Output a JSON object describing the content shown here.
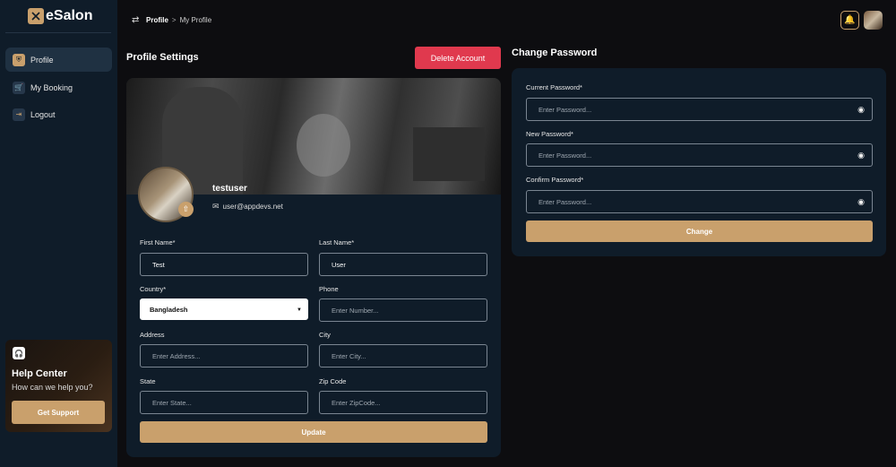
{
  "brand": {
    "name": "eSalon",
    "accent": "#c9a06c",
    "danger": "#e0394e"
  },
  "sidebar": {
    "items": [
      {
        "label": "Profile",
        "icon": "shield-user-icon",
        "active": true
      },
      {
        "label": "My Booking",
        "icon": "cart-icon",
        "active": false
      },
      {
        "label": "Logout",
        "icon": "logout-icon",
        "active": false
      }
    ],
    "help": {
      "title": "Help Center",
      "subtitle": "How can we help you?",
      "button": "Get Support"
    }
  },
  "header": {
    "breadcrumb": [
      "Profile",
      "My Profile"
    ]
  },
  "profile": {
    "title": "Profile Settings",
    "delete_label": "Delete Account",
    "username": "testuser",
    "email": "user@appdevs.net",
    "fields": {
      "first_name": {
        "label": "First Name*",
        "value": "Test"
      },
      "last_name": {
        "label": "Last Name*",
        "value": "User"
      },
      "country": {
        "label": "Country*",
        "value": "Bangladesh"
      },
      "phone": {
        "label": "Phone",
        "placeholder": "Enter Number..."
      },
      "address": {
        "label": "Address",
        "placeholder": "Enter Address..."
      },
      "city": {
        "label": "City",
        "placeholder": "Enter City..."
      },
      "state": {
        "label": "State",
        "placeholder": "Enter State..."
      },
      "zip": {
        "label": "Zip Code",
        "placeholder": "Enter ZipCode..."
      }
    },
    "update_label": "Update"
  },
  "password": {
    "title": "Change Password",
    "current": {
      "label": "Current Password*",
      "placeholder": "Enter Password..."
    },
    "new": {
      "label": "New Password*",
      "placeholder": "Enter Password..."
    },
    "confirm": {
      "label": "Confirm Password*",
      "placeholder": "Enter Password..."
    },
    "change_label": "Change"
  }
}
